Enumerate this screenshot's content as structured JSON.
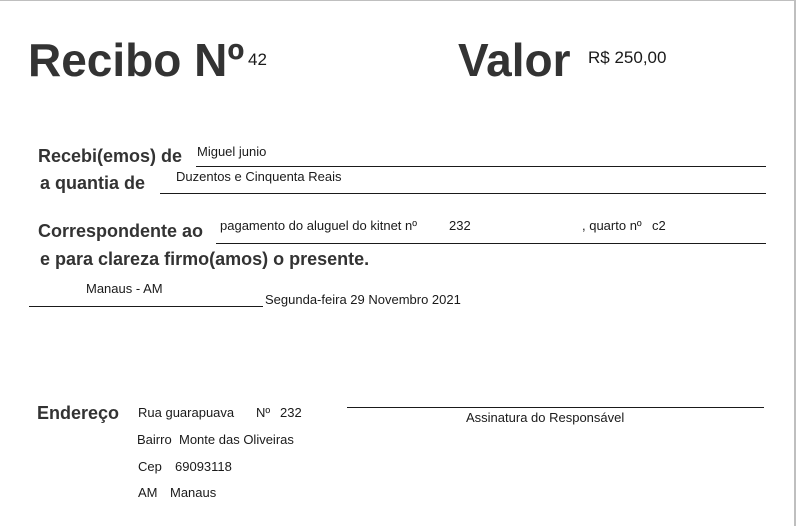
{
  "header": {
    "receipt_label": "Recibo Nº",
    "receipt_number": "42",
    "value_label": "Valor",
    "value_amount": "R$ 250,00"
  },
  "body": {
    "received_from_label": "Recebi(emos) de",
    "received_from_value": "Miguel junio",
    "amount_label": "a quantia de",
    "amount_words": "Duzentos e Cinquenta Reais",
    "corresponding_label": "Correspondente ao",
    "corresponding_text": "pagamento do aluguel do kitnet nº",
    "kitnet_number": "232",
    "room_label": ", quarto nº",
    "room_number": "c2",
    "clarity_text": "e para clareza firmo(amos) o presente."
  },
  "place_date": {
    "place": "Manaus - AM",
    "date": "Segunda-feira 29 Novembro 2021"
  },
  "address": {
    "label": "Endereço",
    "street": "Rua guarapuava",
    "number_label": "Nº",
    "number": "232",
    "district_label": "Bairro",
    "district": "Monte das Oliveiras",
    "cep_label": "Cep",
    "cep": "69093118",
    "state": "AM",
    "city": "Manaus"
  },
  "signature": {
    "label": "Assinatura do Responsável"
  }
}
